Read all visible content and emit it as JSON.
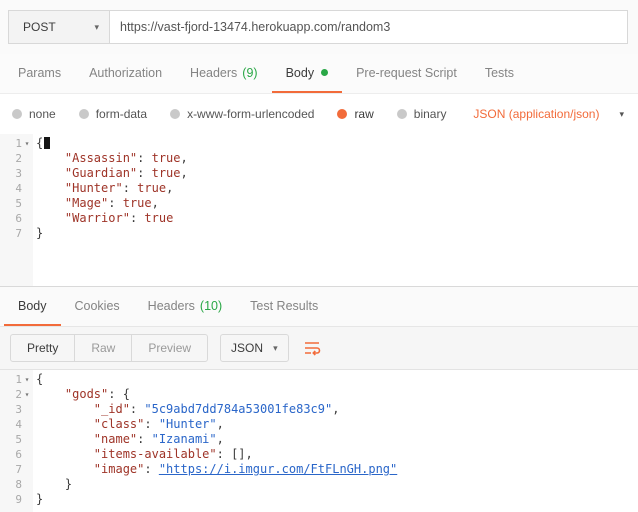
{
  "colors": {
    "accent": "#f26b3a",
    "green": "#29a746",
    "key": "#9e3327",
    "string": "#2a66c9"
  },
  "request": {
    "method": "POST",
    "url": "https://vast-fjord-13474.herokuapp.com/random3",
    "tabs": [
      {
        "label": "Params"
      },
      {
        "label": "Authorization"
      },
      {
        "label": "Headers",
        "count": "(9)"
      },
      {
        "label": "Body",
        "active": true,
        "dot": true
      },
      {
        "label": "Pre-request Script"
      },
      {
        "label": "Tests"
      }
    ],
    "body_modes": [
      {
        "label": "none"
      },
      {
        "label": "form-data"
      },
      {
        "label": "x-www-form-urlencoded"
      },
      {
        "label": "raw",
        "selected": true
      },
      {
        "label": "binary"
      }
    ],
    "content_type": "JSON (application/json)",
    "code": [
      {
        "n": 1,
        "fold": true,
        "seg": [
          [
            "{",
            "p"
          ],
          [
            "",
            "cursor"
          ]
        ]
      },
      {
        "n": 2,
        "seg": [
          [
            "    ",
            "p"
          ],
          [
            "\"Assassin\"",
            "k"
          ],
          [
            ": ",
            "p"
          ],
          [
            "true",
            "b"
          ],
          [
            ",",
            "p"
          ]
        ]
      },
      {
        "n": 3,
        "seg": [
          [
            "    ",
            "p"
          ],
          [
            "\"Guardian\"",
            "k"
          ],
          [
            ": ",
            "p"
          ],
          [
            "true",
            "b"
          ],
          [
            ",",
            "p"
          ]
        ]
      },
      {
        "n": 4,
        "seg": [
          [
            "    ",
            "p"
          ],
          [
            "\"Hunter\"",
            "k"
          ],
          [
            ": ",
            "p"
          ],
          [
            "true",
            "b"
          ],
          [
            ",",
            "p"
          ]
        ]
      },
      {
        "n": 5,
        "seg": [
          [
            "    ",
            "p"
          ],
          [
            "\"Mage\"",
            "k"
          ],
          [
            ": ",
            "p"
          ],
          [
            "true",
            "b"
          ],
          [
            ",",
            "p"
          ]
        ]
      },
      {
        "n": 6,
        "seg": [
          [
            "    ",
            "p"
          ],
          [
            "\"Warrior\"",
            "k"
          ],
          [
            ": ",
            "p"
          ],
          [
            "true",
            "b"
          ]
        ]
      },
      {
        "n": 7,
        "seg": [
          [
            "}",
            "p"
          ]
        ]
      }
    ]
  },
  "response": {
    "tabs": [
      {
        "label": "Body",
        "active": true
      },
      {
        "label": "Cookies"
      },
      {
        "label": "Headers",
        "count": "(10)"
      },
      {
        "label": "Test Results"
      }
    ],
    "views": [
      {
        "label": "Pretty",
        "active": true
      },
      {
        "label": "Raw"
      },
      {
        "label": "Preview"
      }
    ],
    "format": "JSON",
    "code": [
      {
        "n": 1,
        "fold": true,
        "seg": [
          [
            "{",
            "p"
          ]
        ]
      },
      {
        "n": 2,
        "fold": true,
        "seg": [
          [
            "    ",
            "p"
          ],
          [
            "\"gods\"",
            "k"
          ],
          [
            ": ",
            "p"
          ],
          [
            "{",
            "p"
          ]
        ]
      },
      {
        "n": 3,
        "seg": [
          [
            "        ",
            "p"
          ],
          [
            "\"_id\"",
            "k"
          ],
          [
            ": ",
            "p"
          ],
          [
            "\"5c9abd7dd784a53001fe83c9\"",
            "s"
          ],
          [
            ",",
            "p"
          ]
        ]
      },
      {
        "n": 4,
        "seg": [
          [
            "        ",
            "p"
          ],
          [
            "\"class\"",
            "k"
          ],
          [
            ": ",
            "p"
          ],
          [
            "\"Hunter\"",
            "s"
          ],
          [
            ",",
            "p"
          ]
        ]
      },
      {
        "n": 5,
        "seg": [
          [
            "        ",
            "p"
          ],
          [
            "\"name\"",
            "k"
          ],
          [
            ": ",
            "p"
          ],
          [
            "\"Izanami\"",
            "s"
          ],
          [
            ",",
            "p"
          ]
        ]
      },
      {
        "n": 6,
        "seg": [
          [
            "        ",
            "p"
          ],
          [
            "\"items-available\"",
            "k"
          ],
          [
            ": ",
            "p"
          ],
          [
            "[]",
            "p"
          ],
          [
            ",",
            "p"
          ]
        ]
      },
      {
        "n": 7,
        "seg": [
          [
            "        ",
            "p"
          ],
          [
            "\"image\"",
            "k"
          ],
          [
            ": ",
            "p"
          ],
          [
            "\"https://i.imgur.com/FtFLnGH.png\"",
            "u"
          ]
        ]
      },
      {
        "n": 8,
        "seg": [
          [
            "    ",
            "p"
          ],
          [
            "}",
            "p"
          ]
        ]
      },
      {
        "n": 9,
        "seg": [
          [
            "}",
            "p"
          ]
        ]
      }
    ]
  }
}
